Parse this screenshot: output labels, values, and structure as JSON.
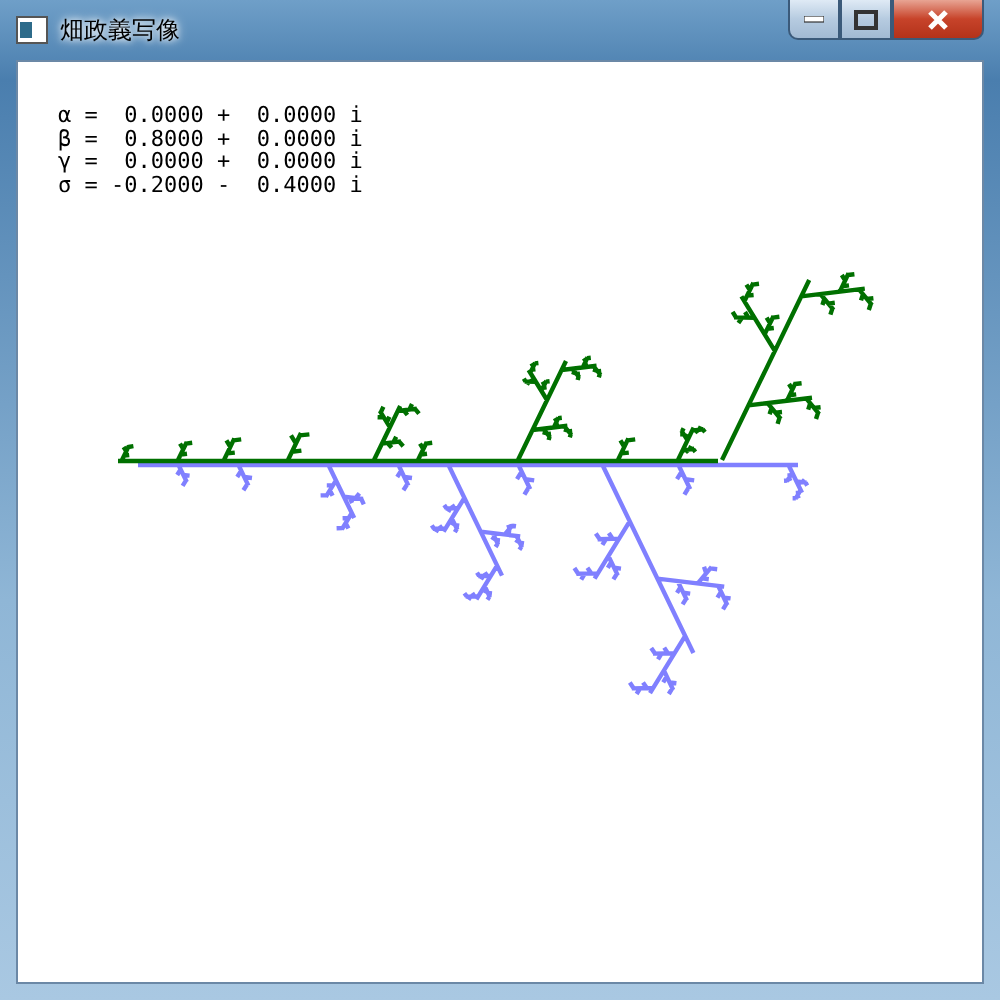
{
  "window": {
    "title": "畑政義写像"
  },
  "parameters": [
    {
      "line": "α =  0.0000 +  0.0000 i"
    },
    {
      "line": "β =  0.8000 +  0.0000 i"
    },
    {
      "line": "γ =  0.0000 +  0.0000 i"
    },
    {
      "line": "σ = -0.2000 -  0.4000 i"
    }
  ]
}
